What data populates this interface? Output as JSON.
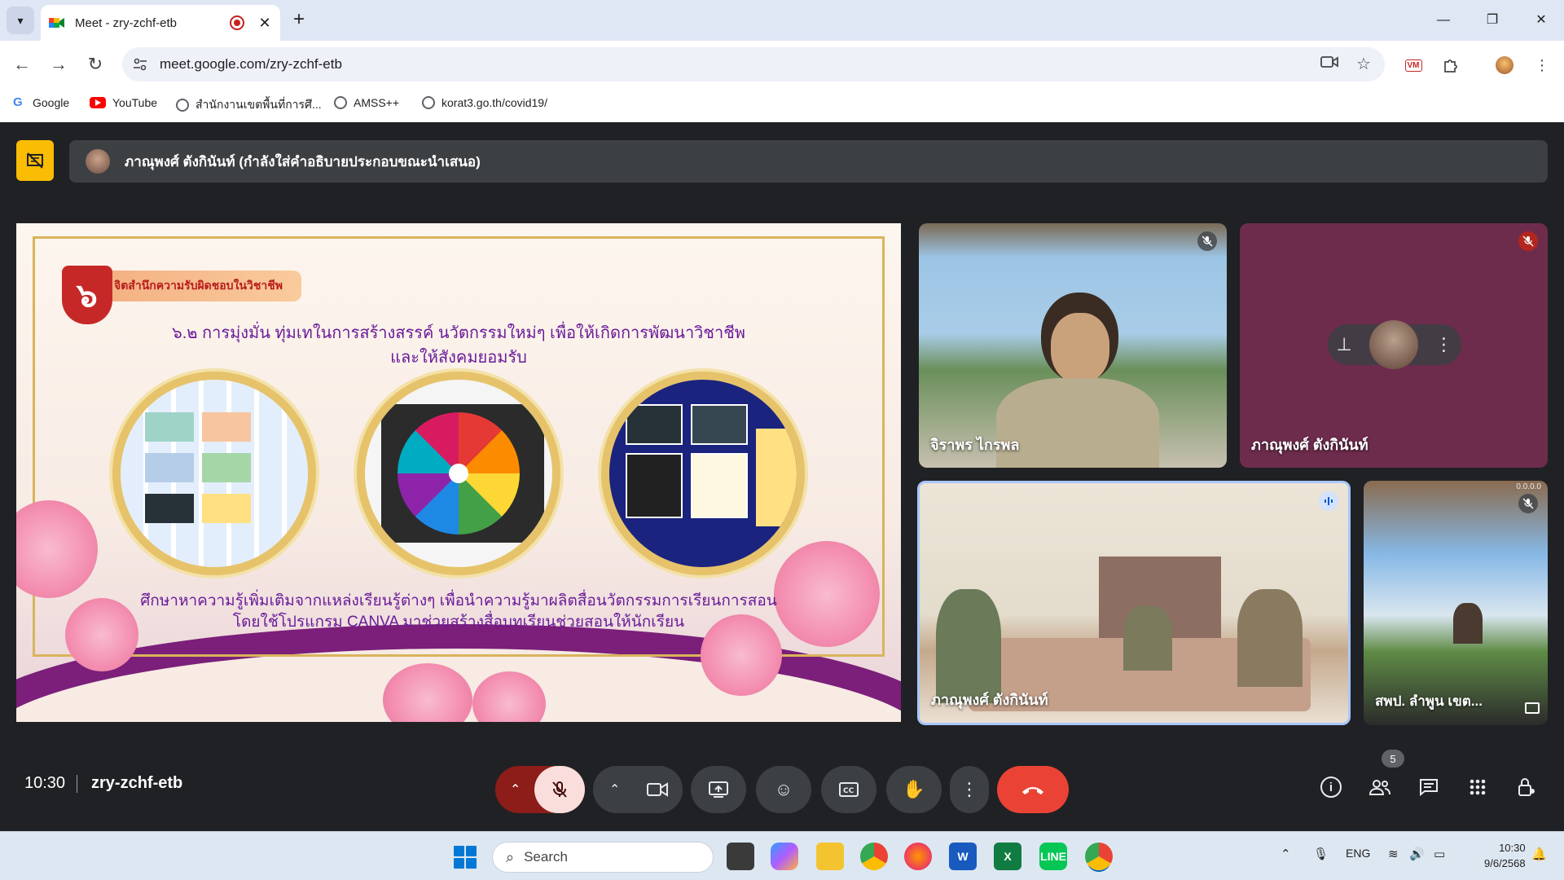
{
  "browser": {
    "tab_title": "Meet - zry-zchf-etb",
    "tab_close": "✕",
    "new_tab": "+",
    "url": "meet.google.com/zry-zchf-etb",
    "bookmarks": [
      {
        "label": "Google",
        "icon": "google-icon"
      },
      {
        "label": "YouTube",
        "icon": "youtube-icon"
      },
      {
        "label": "สำนักงานเขตพื้นที่การศึ...",
        "icon": "globe-icon"
      },
      {
        "label": "AMSS++",
        "icon": "globe-icon"
      },
      {
        "label": "korat3.go.th/covid19/",
        "icon": "globe-icon"
      }
    ],
    "extension_badge": "VM"
  },
  "meet": {
    "presenter_banner": "ภาณุพงศ์ ตังกินันท์ (กำลังใส่คำอธิบายประกอบขณะนำเสนอ)",
    "slide": {
      "badge_number": "๖",
      "ribbon": "จิตสำนึกความรับผิดชอบในวิชาชีพ",
      "heading_line1": "๖.๒ การมุ่งมั่น ทุ่มเทในการสร้างสรรค์ นวัตกรรมใหม่ๆ เพื่อให้เกิดการพัฒนาวิชาชีพ",
      "heading_line2": "และให้สังคมยอมรับ",
      "footer_line1": "ศึกษาหาความรู้เพิ่มเติมจากแหล่งเรียนรู้ต่างๆ เพื่อนำความรู้มาผลิตสื่อนวัตกรรมการเรียนการสอน",
      "footer_line2": "โดยใช้โปรแกรม CANVA มาช่วยสร้างสื่อบทเรียนช่วยสอนให้นักเรียน"
    },
    "participants": [
      {
        "name": "จิราพร ไกรพล",
        "muted": true
      },
      {
        "name": "ภาณุพงศ์ ตังกินันท์",
        "muted": true
      },
      {
        "name": "ภาณุพงศ์ ตังกินันท์",
        "speaking": true
      },
      {
        "name": "สพป. ลำพูน เขต...",
        "muted": true,
        "overlay_text": "0.0.0.0"
      }
    ],
    "clock": "10:30",
    "meeting_code": "zry-zchf-etb",
    "people_count": "5"
  },
  "taskbar": {
    "search_placeholder": "Search",
    "lang": "ENG",
    "time": "10:30",
    "date": "9/6/2568"
  },
  "colors": {
    "meet_bg": "#202124",
    "end_call": "#ea4335",
    "mic_off_bg": "#f9dedc",
    "layout_btn": "#fbbc04",
    "speaking_border": "#a8c7fa"
  }
}
